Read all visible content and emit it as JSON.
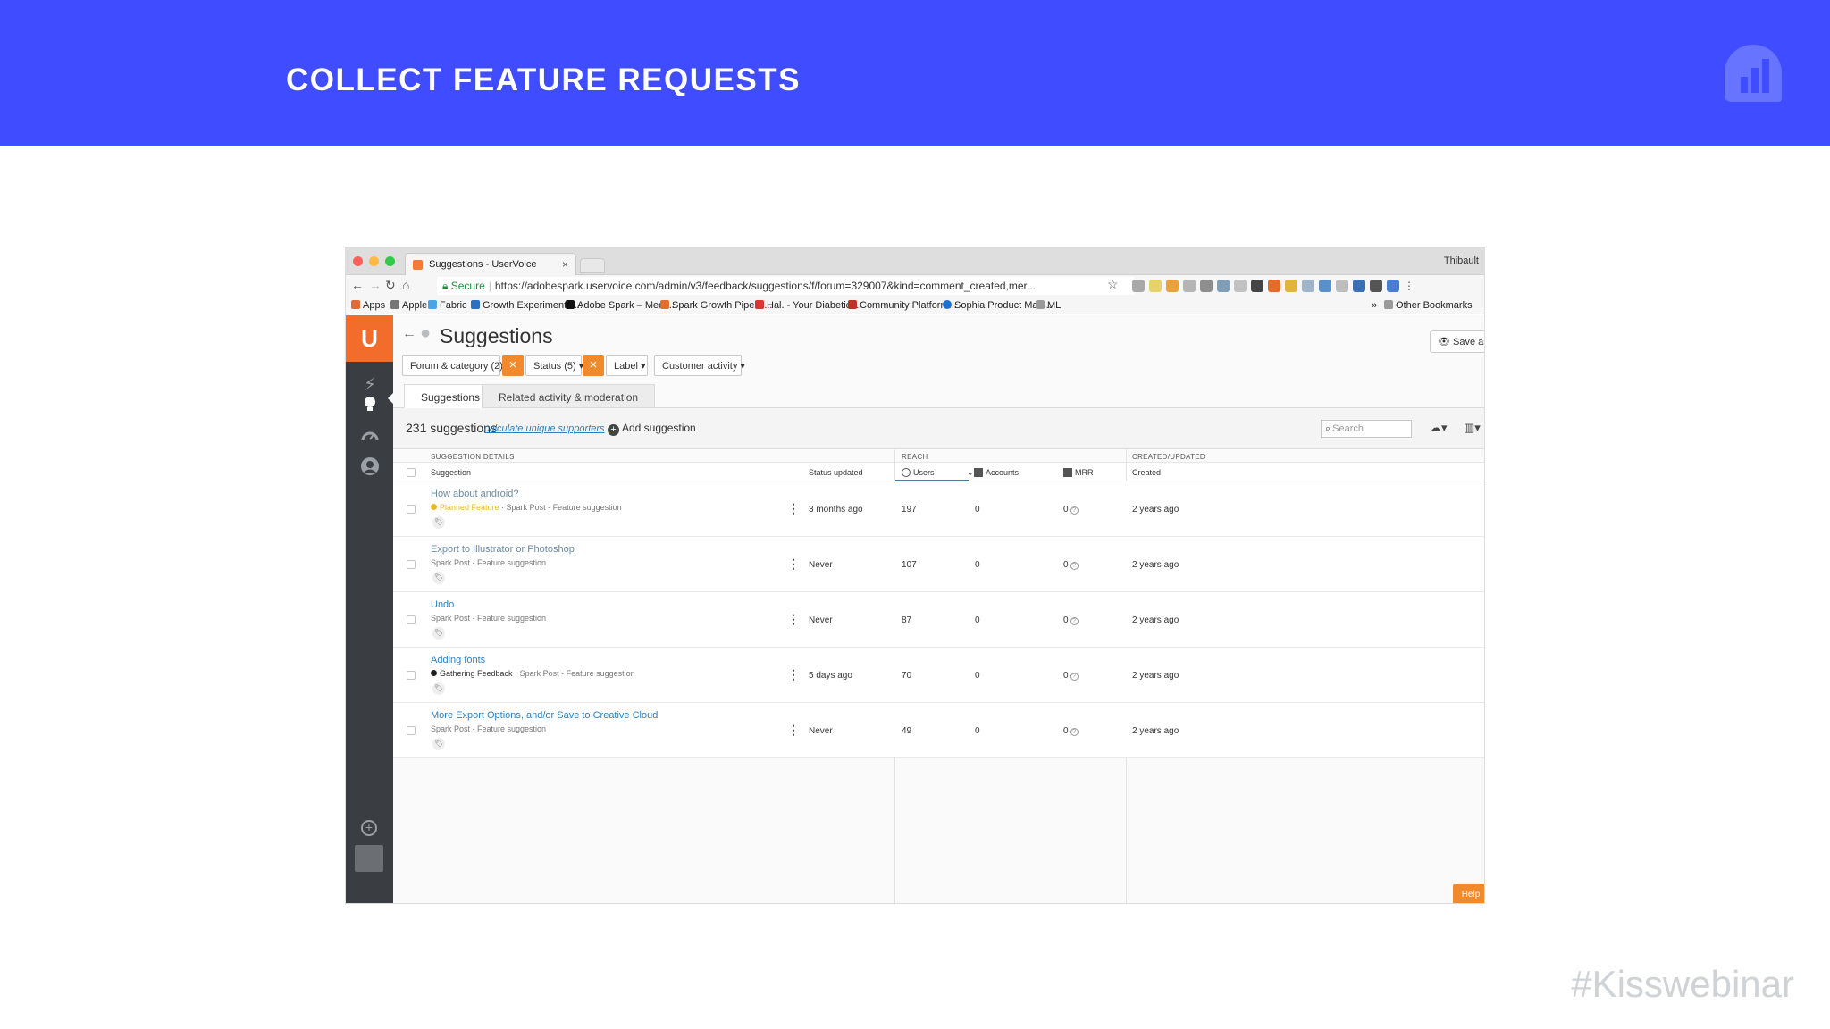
{
  "slide": {
    "title": "COLLECT FEATURE REQUESTS",
    "hashtag": "#Kisswebinar",
    "colors": {
      "header_bg": "#3f4cff",
      "accent_orange": "#f18a2d",
      "link_blue": "#2d7fbc"
    }
  },
  "browser": {
    "tab_title": "Suggestions - UserVoice",
    "tab_close": "×",
    "profile_name": "Thibault",
    "secure_label": "Secure",
    "url": "https://adobespark.uservoice.com/admin/v3/feedback/suggestions/f/forum=329007&kind=comment_created,mer...",
    "bookmarks": [
      {
        "label": "Apps",
        "icon": "apps-grid-icon"
      },
      {
        "label": "Apple",
        "icon": "apple-icon"
      },
      {
        "label": "Fabric",
        "icon": "fabric-icon"
      },
      {
        "label": "Growth Experiments:...",
        "icon": "folder-icon"
      },
      {
        "label": "Adobe Spark – Medi...",
        "icon": "medium-icon"
      },
      {
        "label": "Spark Growth Pipelin...",
        "icon": "chart-icon"
      },
      {
        "label": "Hal. - Your Diabetic...",
        "icon": "hal-icon"
      },
      {
        "label": "Community Platform...",
        "icon": "community-icon"
      },
      {
        "label": "Sophia Product Man...",
        "icon": "circle-icon"
      },
      {
        "label": "ML",
        "icon": "folder-icon"
      }
    ],
    "bookmarks_overflow": "»",
    "other_bookmarks": "Other Bookmarks"
  },
  "app": {
    "logo_text": "U",
    "page_title": "Suggestions",
    "save_button": "Save as...",
    "filters": [
      {
        "label": "Forum & category (2)",
        "removable": true
      },
      {
        "label": "Status (5)",
        "removable": true
      },
      {
        "label": "Label",
        "removable": false
      },
      {
        "label": "Customer activity",
        "removable": false
      }
    ],
    "filter_remove": "×",
    "tabs": [
      {
        "label": "Suggestions",
        "active": true
      },
      {
        "label": "Related activity & moderation",
        "active": false
      }
    ],
    "count_label": "231 suggestions",
    "calc_link": "calculate unique supporters",
    "add_suggestion": "Add suggestion",
    "search_placeholder": "Search",
    "groups": {
      "details": "SUGGESTION DETAILS",
      "reach": "REACH",
      "created": "CREATED/UPDATED"
    },
    "columns": {
      "suggestion": "Suggestion",
      "status_updated": "Status updated",
      "users": "Users",
      "accounts": "Accounts",
      "mrr": "MRR",
      "created": "Created"
    },
    "rows": [
      {
        "title": "How about android?",
        "status": "Planned Feature",
        "status_color": "#e8b730",
        "category": "Spark Post - Feature suggestion",
        "status_updated": "3 months ago",
        "users": "197",
        "accounts": "0",
        "mrr": "0",
        "created": "2 years ago"
      },
      {
        "title": "Export to Illustrator or Photoshop",
        "status": "",
        "status_color": "",
        "category": "Spark Post - Feature suggestion",
        "status_updated": "Never",
        "users": "107",
        "accounts": "0",
        "mrr": "0",
        "created": "2 years ago"
      },
      {
        "title": "Undo",
        "status": "",
        "status_color": "",
        "category": "Spark Post - Feature suggestion",
        "status_updated": "Never",
        "users": "87",
        "accounts": "0",
        "mrr": "0",
        "created": "2 years ago"
      },
      {
        "title": "Adding fonts",
        "status": "Gathering Feedback",
        "status_color": "#222222",
        "category": "Spark Post - Feature suggestion",
        "status_updated": "5 days ago",
        "users": "70",
        "accounts": "0",
        "mrr": "0",
        "created": "2 years ago"
      },
      {
        "title": "More Export Options, and/or Save to Creative Cloud",
        "status": "",
        "status_color": "",
        "category": "Spark Post - Feature suggestion",
        "status_updated": "Never",
        "users": "49",
        "accounts": "0",
        "mrr": "0",
        "created": "2 years ago"
      }
    ],
    "help_button": "Help"
  }
}
